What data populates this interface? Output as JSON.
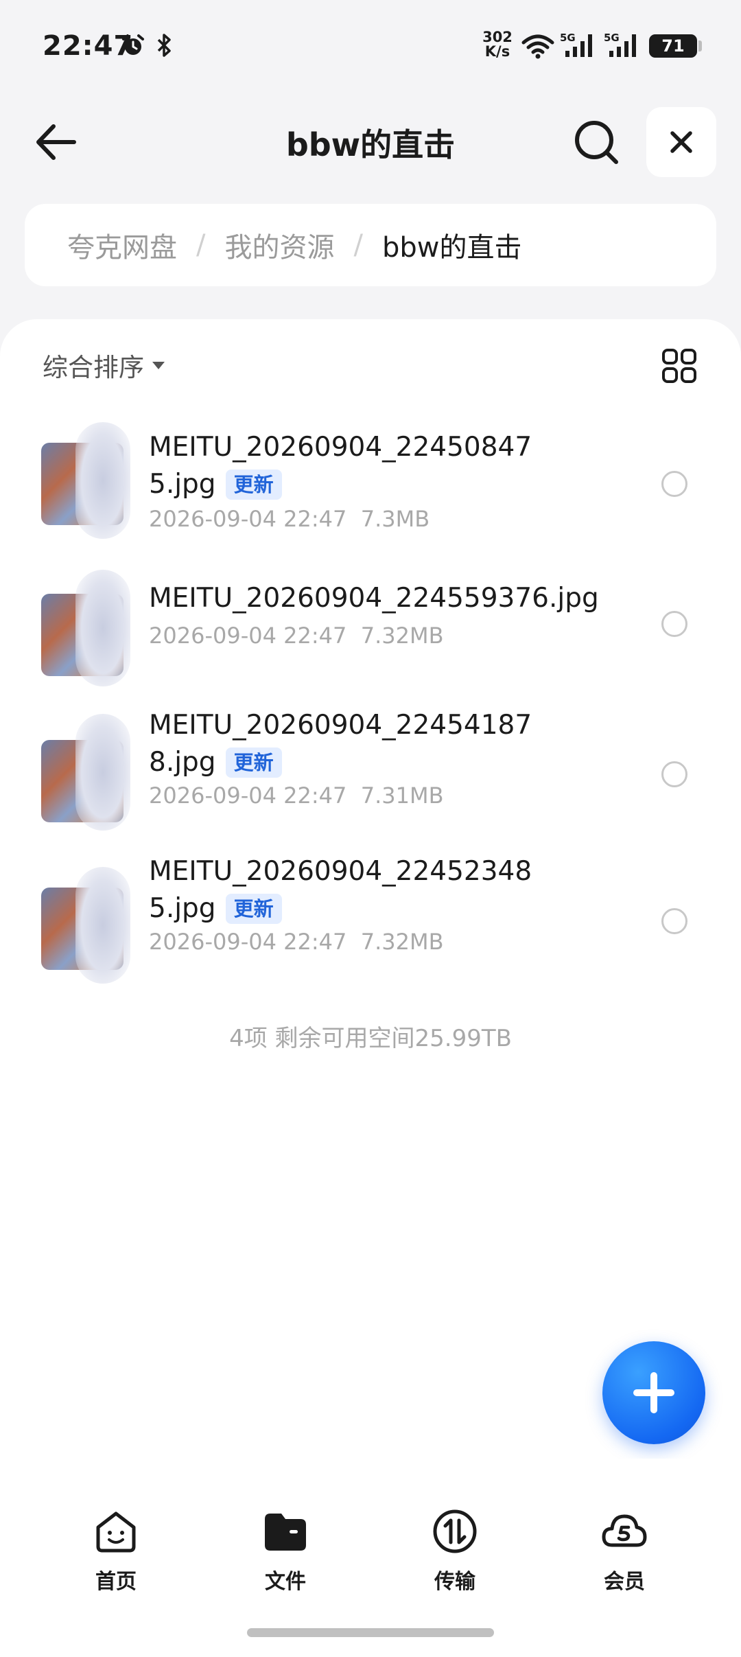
{
  "status_bar": {
    "time": "22:47",
    "net_speed_value": "302",
    "net_speed_unit": "K/s",
    "battery": "71",
    "icons": [
      "alarm-icon",
      "bluetooth-icon",
      "wifi-icon",
      "signal-5g-icon",
      "signal-5g-icon"
    ]
  },
  "header": {
    "title": "bbw的直击",
    "back_icon": "arrow-left-icon",
    "search_icon": "search-icon",
    "close_icon": "close-icon"
  },
  "breadcrumb": {
    "items": [
      "夸克网盘",
      "我的资源"
    ],
    "separator": "/",
    "current": "bbw的直击"
  },
  "toolbar": {
    "sort_label": "综合排序",
    "view_toggle_icon": "grid-view-icon"
  },
  "files": [
    {
      "name_line1": "MEITU_20260904_22450847",
      "name_line2": "5.jpg",
      "badge": "更新",
      "date": "2026-09-04 22:47",
      "size": "7.3MB"
    },
    {
      "name_line1": "MEITU_20260904_224559376.jpg",
      "name_line2": "",
      "badge": "",
      "date": "2026-09-04 22:47",
      "size": "7.32MB"
    },
    {
      "name_line1": "MEITU_20260904_22454187",
      "name_line2": "8.jpg",
      "badge": "更新",
      "date": "2026-09-04 22:47",
      "size": "7.31MB"
    },
    {
      "name_line1": "MEITU_20260904_22452348",
      "name_line2": "5.jpg",
      "badge": "更新",
      "date": "2026-09-04 22:47",
      "size": "7.32MB"
    }
  ],
  "footer_note": "4项 剩余可用空间25.99TB",
  "fab": {
    "icon": "plus-icon"
  },
  "bottom_nav": [
    {
      "label": "首页",
      "icon": "home-smile-icon"
    },
    {
      "label": "文件",
      "icon": "folder-icon"
    },
    {
      "label": "传输",
      "icon": "transfer-icon"
    },
    {
      "label": "会员",
      "icon": "vip-cloud-icon"
    }
  ],
  "colors": {
    "accent": "#1468f2",
    "badge_bg": "#e3edff",
    "badge_text": "#2164d9",
    "background": "#f4f4f6"
  }
}
